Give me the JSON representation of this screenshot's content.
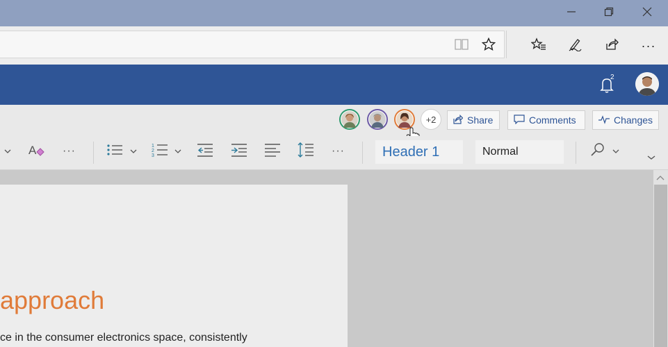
{
  "window": {
    "controls": [
      "minimize-icon",
      "restore-icon",
      "close-icon"
    ]
  },
  "browser": {
    "toolbar_icons": [
      "reading-view-icon",
      "favorite-star-icon",
      "favorites-list-icon",
      "pen-icon",
      "share-icon",
      "more-icon"
    ],
    "more_label": "···"
  },
  "app": {
    "header_color": "#2f5596",
    "notification_count": "2"
  },
  "collab": {
    "extra_users": "+2",
    "share_label": "Share",
    "comments_label": "Comments",
    "changes_label": "Changes"
  },
  "ribbon": {
    "more_label": "···",
    "style_heading": "Header 1",
    "style_normal": "Normal"
  },
  "document": {
    "heading": "approach",
    "body_line": "ce in the consumer electronics space, consistently",
    "heading_color": "#e07b39"
  }
}
